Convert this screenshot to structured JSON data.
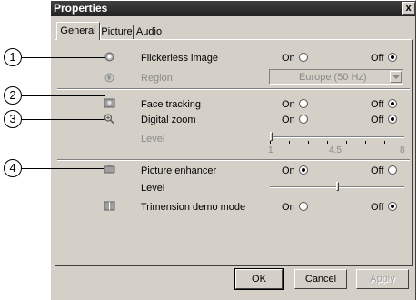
{
  "window": {
    "title": "Properties",
    "close_label": "x"
  },
  "tabs": [
    {
      "label": "General",
      "active": true
    },
    {
      "label": "Picture",
      "active": false
    },
    {
      "label": "Audio",
      "active": false
    }
  ],
  "callouts": [
    "1",
    "2",
    "3",
    "4"
  ],
  "rows": {
    "flickerless": {
      "label": "Flickerless image",
      "on": "On",
      "off": "Off",
      "selected": "Off",
      "icon": "flicker-icon"
    },
    "region": {
      "label": "Region",
      "value": "Europe (50 Hz)",
      "disabled": true,
      "icon": "globe-icon"
    },
    "face_tracking": {
      "label": "Face tracking",
      "on": "On",
      "off": "Off",
      "selected": "Off",
      "icon": "face-tracking-icon"
    },
    "digital_zoom": {
      "label": "Digital zoom",
      "on": "On",
      "off": "Off",
      "selected": "Off",
      "icon": "zoom-icon"
    },
    "zoom_level": {
      "label": "Level",
      "disabled": true,
      "min": "1",
      "mid": "4.5",
      "max": "8",
      "value": 1
    },
    "picture_enhancer": {
      "label": "Picture enhancer",
      "on": "On",
      "off": "Off",
      "selected": "On",
      "icon": "enhancer-icon"
    },
    "enhancer_level": {
      "label": "Level",
      "value": 0.5
    },
    "trimension": {
      "label": "Trimension demo mode",
      "on": "On",
      "off": "Off",
      "selected": "Off",
      "icon": "trimension-icon"
    }
  },
  "buttons": {
    "ok": "OK",
    "cancel": "Cancel",
    "apply": "Apply"
  }
}
